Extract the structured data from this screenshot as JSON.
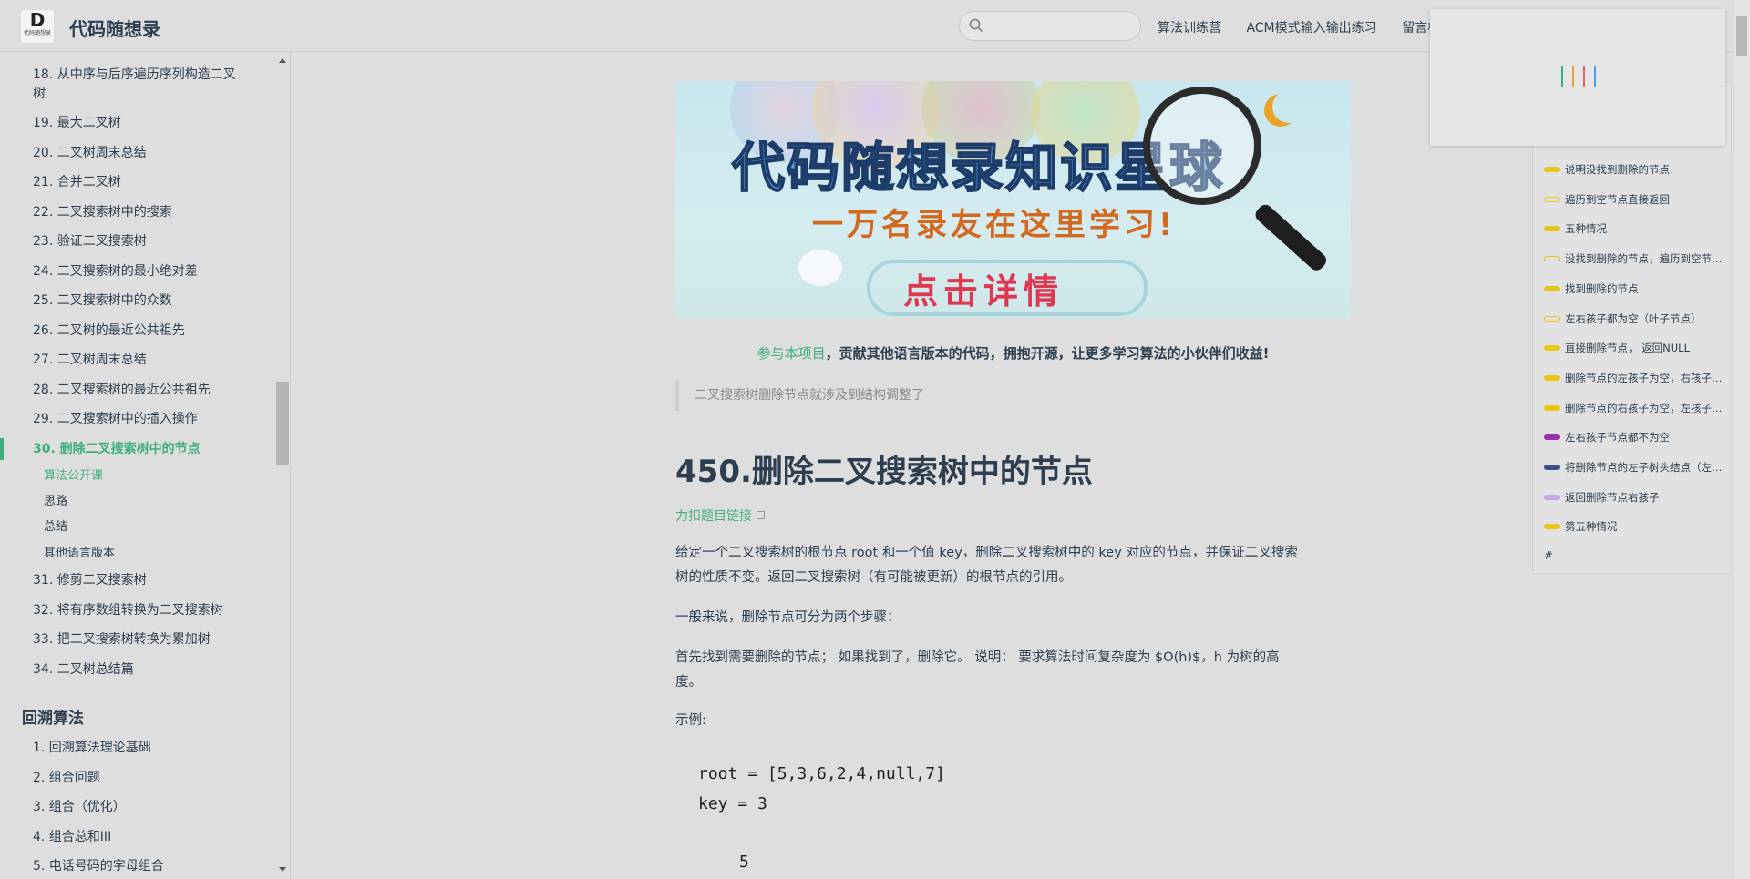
{
  "header": {
    "logo_letter": "D",
    "logo_caption": "代码随想录",
    "site_title": "代码随想录",
    "search_placeholder": "",
    "nav": [
      "算法训练营",
      "ACM模式输入输出练习",
      "留言板"
    ]
  },
  "sidebar": {
    "items": [
      "18. 从中序与后序遍历序列构造二叉",
      "树",
      "19. 最大二叉树",
      "20. 二叉树周末总结",
      "21. 合并二叉树",
      "22. 二叉搜索树中的搜索",
      "23. 验证二叉搜索树",
      "24. 二叉搜索树的最小绝对差",
      "25. 二叉搜索树中的众数",
      "26. 二叉树的最近公共祖先",
      "27. 二叉树周末总结",
      "28. 二叉搜索树的最近公共祖先",
      "29. 二叉搜索树中的插入操作"
    ],
    "active_item": "30. 删除二叉搜索树中的节点",
    "sub_items": [
      "算法公开课",
      "思路",
      "总结",
      "其他语言版本"
    ],
    "after_items": [
      "31. 修剪二叉搜索树",
      "32. 将有序数组转换为二叉搜索树",
      "33. 把二叉搜索树转换为累加树",
      "34. 二叉树总结篇"
    ],
    "group_title": "回溯算法",
    "group_items": [
      "1. 回溯算法理论基础",
      "2. 组合问题",
      "3. 组合（优化）",
      "4. 组合总和III",
      "5. 电话号码的字母组合"
    ]
  },
  "banner": {
    "title": "代码随想录知识星球",
    "subtitle": "一万名录友在这里学习!",
    "cta": "点击详情"
  },
  "content": {
    "contrib_link": "参与本项目",
    "contrib_text": "，贡献其他语言版本的代码，拥抱开源，让更多学习算法的小伙伴们收益!",
    "quote": "二叉搜索树删除节点就涉及到结构调整了",
    "title": "450.删除二叉搜索树中的节点",
    "problem_link": "力扣题目链接",
    "para1_line1": "给定一个二叉搜索树的根节点 root 和一个值 key，删除二叉搜索树中的 key 对应的节点，并保证二叉搜索",
    "para1_line2": "树的性质不变。返回二叉搜索树（有可能被更新）的根节点的引用。",
    "para2": "一般来说，删除节点可分为两个步骤：",
    "para3_line1": "首先找到需要删除的节点； 如果找到了，删除它。 说明： 要求算法时间复杂度为 $O(h)$，h 为树的高",
    "para3_line2": "度。",
    "para4": "示例:",
    "code_line1": "root = [5,3,6,2,4,null,7]",
    "code_line2": "key = 3",
    "code_line3": "5"
  },
  "toc": {
    "items": [
      {
        "label": "说明没找到删除的节点",
        "color": "#e6c619",
        "filled": true
      },
      {
        "label": "遍历到空节点直接返回",
        "color": "#e6c619",
        "filled": false
      },
      {
        "label": "五种情况",
        "color": "#e6c619",
        "filled": true
      },
      {
        "label": "没找到删除的节点，遍历到空节点直接返回",
        "color": "#e6c619",
        "filled": false
      },
      {
        "label": "找到删除的节点",
        "color": "#e6c619",
        "filled": true
      },
      {
        "label": "左右孩子都为空（叶子节点）",
        "color": "#e6c619",
        "filled": false
      },
      {
        "label": "直接删除节点， 返回NULL",
        "color": "#e6c619",
        "filled": true
      },
      {
        "label": "删除节点的左孩子为空，右孩子不为空",
        "color": "#e6c619",
        "filled": true
      },
      {
        "label": "删除节点的右孩子为空，左孩子不为空",
        "color": "#e6c619",
        "filled": true
      },
      {
        "label": "左右孩子节点都不为空",
        "color": "#9b2fae",
        "filled": true
      },
      {
        "label": "将删除节点的左子树头结点（左孩子）",
        "color": "#3a4f8a",
        "filled": true
      },
      {
        "label": "返回删除节点右孩子",
        "color": "#c9a6e6",
        "filled": true
      },
      {
        "label": "第五种情况",
        "color": "#e6c619",
        "filled": true
      }
    ],
    "hash": "#"
  },
  "loader": {
    "bar_colors": [
      "#3eaf7c",
      "#e6a23c",
      "#e06666",
      "#409eff"
    ]
  }
}
